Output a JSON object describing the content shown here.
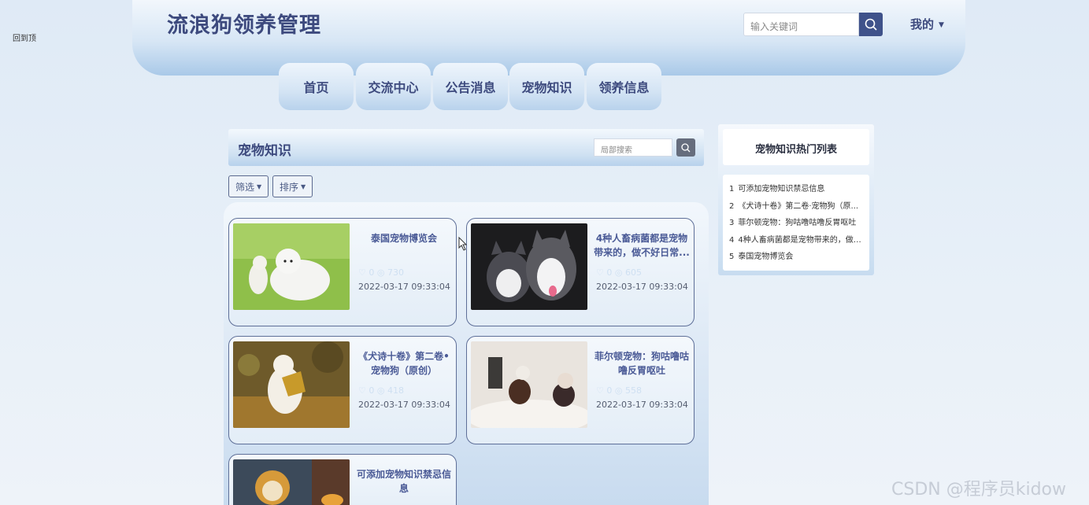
{
  "corner_label": "回到顶",
  "header": {
    "site_title": "流浪狗领养管理",
    "search_placeholder": "输入关键词",
    "my_menu": "我的"
  },
  "nav": [
    "首页",
    "交流中心",
    "公告消息",
    "宠物知识",
    "领养信息"
  ],
  "section": {
    "title": "宠物知识",
    "local_search_placeholder": "局部搜索",
    "filter_label": "筛选",
    "sort_label": "排序"
  },
  "cards": [
    {
      "title": "泰国宠物博览会",
      "likes": "0",
      "views": "730",
      "date": "2022-03-17 09:33:04"
    },
    {
      "title": "4种人畜病菌都是宠物带来的，做不好日常...",
      "likes": "0",
      "views": "605",
      "date": "2022-03-17 09:33:04"
    },
    {
      "title": "《犬诗十卷》第二卷•宠物狗（原创）",
      "likes": "0",
      "views": "418",
      "date": "2022-03-17 09:33:04"
    },
    {
      "title": "菲尔顿宠物：狗咕噜咕噜反胃呕吐",
      "likes": "0",
      "views": "558",
      "date": "2022-03-17 09:33:04"
    },
    {
      "title": "可添加宠物知识禁忌信息",
      "likes": "",
      "views": "",
      "date": ""
    }
  ],
  "side": {
    "title": "宠物知识热门列表",
    "items": [
      {
        "num": "1",
        "text": "可添加宠物知识禁忌信息"
      },
      {
        "num": "2",
        "text": "《犬诗十卷》第二卷·宠物狗（原..."
      },
      {
        "num": "3",
        "text": "菲尔顿宠物：狗咕噜咕噜反胃呕吐"
      },
      {
        "num": "4",
        "text": "4种人畜病菌都是宠物带来的，做..."
      },
      {
        "num": "5",
        "text": "泰国宠物博览会"
      }
    ]
  },
  "watermark": "CSDN @程序员kidow",
  "icons": {
    "search": "search-icon",
    "caret": "caret-down-icon",
    "like": "like-icon",
    "view": "eye-icon"
  }
}
